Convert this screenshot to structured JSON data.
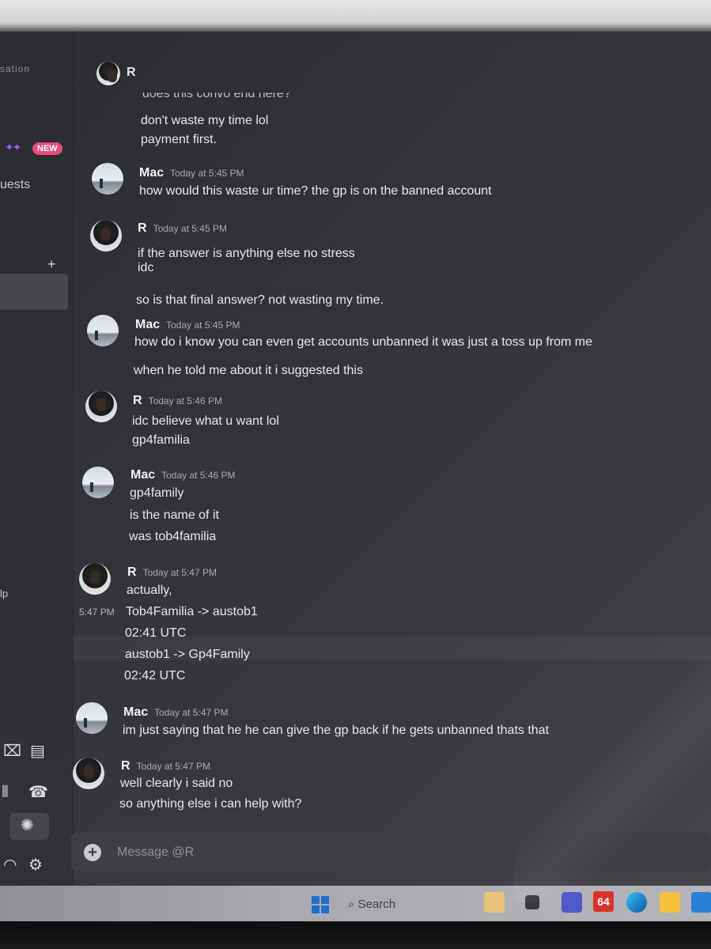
{
  "sidebar": {
    "conversation_label": "sation",
    "new_badge": "NEW",
    "quests_label": "uests",
    "add_label": "+",
    "help_label": "lp"
  },
  "header": {
    "contact_name": "R",
    "cutoff_message": "does this convo end here?"
  },
  "messages": [
    {
      "author": "",
      "time": "",
      "lines": [
        "don't waste my time lol",
        "payment first."
      ]
    },
    {
      "author": "Mac",
      "time": "Today at 5:45 PM",
      "lines": [
        "how would this waste ur time? the gp is on the banned account"
      ]
    },
    {
      "author": "R",
      "time": "Today at 5:45 PM",
      "lines": [
        "if the answer is anything else no stress",
        "idc",
        "so is that final answer? not wasting my time."
      ]
    },
    {
      "author": "Mac",
      "time": "Today at 5:45 PM",
      "lines": [
        "how do i know you can even get accounts unbanned it was just a toss up from me",
        "when he told me about it i suggested this"
      ]
    },
    {
      "author": "R",
      "time": "Today at 5:46 PM",
      "lines": [
        "idc believe what u want lol",
        "gp4familia"
      ]
    },
    {
      "author": "Mac",
      "time": "Today at 5:46 PM",
      "lines": [
        "gp4family",
        "is the name of it",
        "was tob4familia"
      ]
    },
    {
      "author": "R",
      "time": "Today at 5:47 PM",
      "side_time": "5:47 PM",
      "lines": [
        "actually,",
        "Tob4Familia -> austob1",
        "02:41 UTC",
        "austob1 -> Gp4Family",
        "02:42 UTC"
      ]
    },
    {
      "author": "Mac",
      "time": "Today at 5:47 PM",
      "lines": [
        "im just saying that he he can give the gp back if he gets unbanned thats that"
      ]
    },
    {
      "author": "R",
      "time": "Today at 5:47 PM",
      "lines": [
        "well clearly i said no",
        "so anything else i can help with?"
      ]
    }
  ],
  "composer": {
    "placeholder": "Message @R"
  },
  "taskbar": {
    "search_label": "Search",
    "badge_64": "64"
  },
  "colors": {
    "background": "#313338",
    "new_badge": "#e64c79",
    "windows_blue": "#1f6fd0"
  }
}
